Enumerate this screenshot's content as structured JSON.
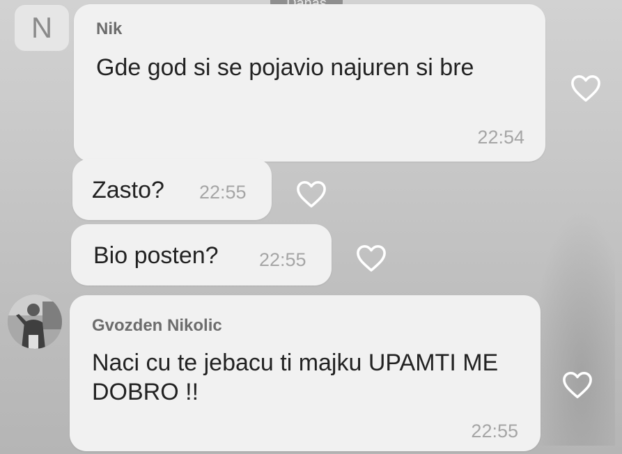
{
  "date_chip": "Danas",
  "avatar_letter": "N",
  "messages": [
    {
      "sender": "Nik",
      "text": "Gde god si se pojavio najuren si bre",
      "time": "22:54"
    },
    {
      "text": "Zasto?",
      "time": "22:55"
    },
    {
      "text": "Bio posten?",
      "time": "22:55"
    },
    {
      "sender": "Gvozden Nikolic",
      "text": "Naci cu te jebacu ti majku UPAMTI ME DOBRO !!",
      "time": "22:55"
    }
  ],
  "icons": {
    "like": "heart-outline-icon"
  },
  "colors": {
    "bubble": "#f1f1f1",
    "sender": "#6c6c6c",
    "time": "#a5a5a5",
    "background": "#c6c6c6"
  }
}
